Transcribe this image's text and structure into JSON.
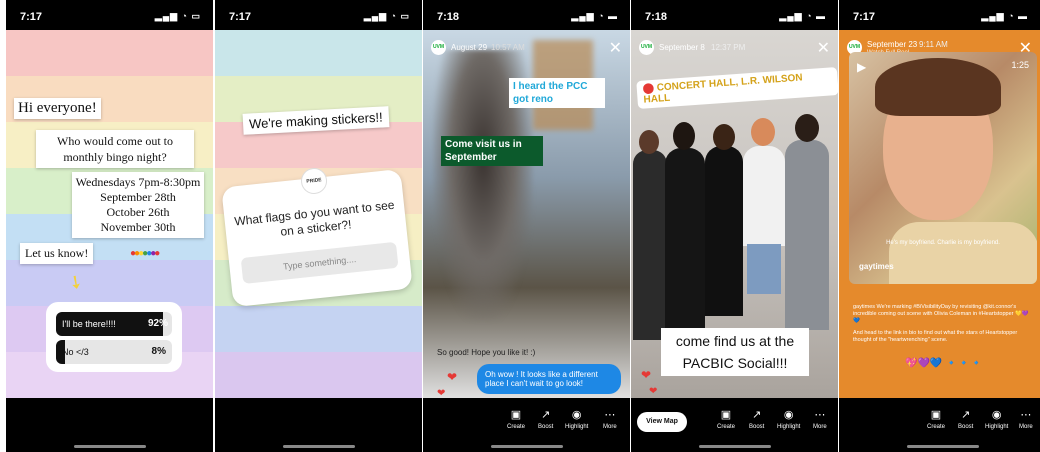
{
  "status_bars": [
    {
      "time": "7:17",
      "icons": "▂▄▆ ◔ ▭"
    },
    {
      "time": "7:17",
      "icons": "▂▄▆ ◔ ▭"
    },
    {
      "time": "7:18",
      "icons": "▂▄▆ ◔ ▬"
    },
    {
      "time": "7:18",
      "icons": "▂▄▆ ◔ ▬"
    },
    {
      "time": "7:17",
      "icons": "▂▄▆ ◔ ▬"
    }
  ],
  "story1": {
    "greeting": "Hi everyone!",
    "question": "Who would come out to monthly bingo night?",
    "dates": [
      "Wednesdays 7pm-8:30pm",
      "September 28th",
      "October 26th",
      "November 30th"
    ],
    "cta": "Let us know!",
    "poll": [
      {
        "label": "I'll be there!!!!",
        "pct": "92%",
        "value": 92
      },
      {
        "label": "No </3",
        "pct": "8%",
        "value": 8
      }
    ]
  },
  "story2": {
    "headline": "We're making stickers!!",
    "logo": "PRIDE",
    "question": "What flags do you want to see on a sticker?!",
    "placeholder": "Type something...."
  },
  "story3": {
    "header_date": "August 29",
    "header_time": "10:57 AM",
    "tag1": "I heard the PCC got reno",
    "tag2": "Come visit us in September",
    "reply_in": "So good! Hope you like it! :)",
    "reply_out": "Oh wow ! It looks like a different place I can't wait to go look!",
    "actions": [
      "Create",
      "Boost",
      "Highlight",
      "More"
    ]
  },
  "story4": {
    "header_date": "September 8",
    "header_time": "12:37 PM",
    "location": "CONCERT HALL, L.R. WILSON HALL",
    "caption": "come find us at the PACBIC Social!!!",
    "view_map": "View Map",
    "actions": [
      "Create",
      "Boost",
      "Highlight",
      "More"
    ]
  },
  "story5": {
    "header_date": "September 23",
    "header_time": "9:11 AM",
    "watch": "Watch Full Reel",
    "duration": "1:25",
    "subtitle": "He's my boyfriend. Charlie is my boyfriend.",
    "account": "gaytimes",
    "caption1": "gaytimes We're marking #BiVisibilityDay by revisiting @kit.connor's incredible coming out scene with Olivia Coleman in #Heartstopper 💛💜💙",
    "caption2": "And head to the link in bio to find out what the stars of Heartstopper thought of the \"heartwrenching\" scene.",
    "hearts": "💖💜💙 🔹🔹🔹",
    "actions": [
      "Create",
      "Boost",
      "Highlight",
      "More"
    ]
  },
  "colors": {
    "story_green": "#0c5a2c",
    "bubble_blue": "#1e88e5",
    "orange": "#e58a2c"
  }
}
